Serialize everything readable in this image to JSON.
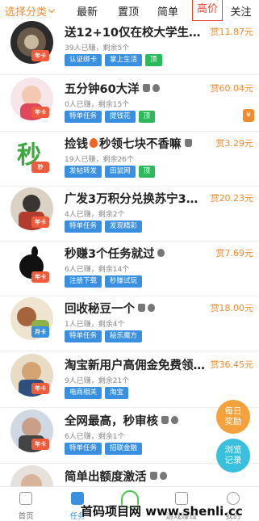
{
  "topbar": {
    "filter_label": "选择分类",
    "tabs": [
      {
        "label": "最新",
        "active": false
      },
      {
        "label": "置顶",
        "active": false
      },
      {
        "label": "简单",
        "active": false
      },
      {
        "label": "高价",
        "active": true
      },
      {
        "label": "关注",
        "active": false
      }
    ]
  },
  "items": [
    {
      "title": "送12+10仅在校大学生认...",
      "price": "赏11.87元",
      "meta": "39人已赚，剩余5个",
      "tags": [
        "认证绑卡",
        "掌上生活",
        "顶"
      ],
      "badge": "年卡",
      "platform_icons": [],
      "fire": false
    },
    {
      "title": "五分钟60大洋",
      "price": "赏60.04元",
      "meta": "0人已赚，剩余15个",
      "tags": [
        "特单任务",
        "提钱花",
        "顶"
      ],
      "badge": "年卡",
      "platform_icons": [
        "android-icon",
        "apple-icon"
      ],
      "fire": false
    },
    {
      "title": "捡钱",
      "title2": "秒领七块不香嘛",
      "price": "赏3.29元",
      "meta": "19人已赚，剩余26个",
      "tags": [
        "发帖转发",
        "田鼠网",
        "顶"
      ],
      "badge": "秒",
      "platform_icons": [
        "android-icon"
      ],
      "fire": true
    },
    {
      "title": "广发3万积分兑换苏宁30...",
      "price": "赏20.23元",
      "meta": "4人已赚，剩余2个",
      "tags": [
        "特单任务",
        "发现精彩"
      ],
      "badge": "年卡",
      "platform_icons": [],
      "fire": false
    },
    {
      "title": "秒赚3个任务就过",
      "price": "赏7.69元",
      "meta": "6人已赚，剩余14个",
      "tags": [
        "注册下载",
        "秒赚试玩"
      ],
      "badge": "年卡",
      "platform_icons": [
        "apple-icon"
      ],
      "fire": false
    },
    {
      "title": "回收秘豆一个",
      "price": "赏18.00元",
      "meta": "1人已赚，剩余4个",
      "tags": [
        "特单任务",
        "秘乐魔方"
      ],
      "badge": "月卡",
      "platform_icons": [
        "android-icon",
        "apple-icon"
      ],
      "fire": false
    },
    {
      "title": "淘宝新用户高佣金免费领...",
      "price": "赏36.45元",
      "meta": "9人已赚，剩余21个",
      "tags": [
        "电商相关",
        "淘宝"
      ],
      "badge": "年卡",
      "platform_icons": [],
      "fire": false
    },
    {
      "title": "全网最高，秒审核",
      "price": "",
      "meta": "6人已赚，剩余1个",
      "tags": [
        "特单任务",
        "招联金融"
      ],
      "badge": "年卡",
      "platform_icons": [
        "android-icon",
        "apple-icon"
      ],
      "fire": false
    },
    {
      "title": "简单出额度激活",
      "price": "",
      "meta": "",
      "tags": [],
      "badge": "",
      "platform_icons": [
        "android-icon",
        "apple-icon"
      ],
      "fire": false
    }
  ],
  "side_badge": "¥",
  "float_buttons": [
    {
      "label": "每日\n奖励",
      "color": "#f5a23c"
    },
    {
      "label": "浏览\n记录",
      "color": "#39c0dd"
    }
  ],
  "bottom_nav": [
    {
      "label": "首页",
      "icon": "home-icon",
      "active": false
    },
    {
      "label": "任务",
      "icon": "task-icon",
      "active": true
    },
    {
      "label": "",
      "icon": "publish-icon",
      "active": false
    },
    {
      "label": "游戏赚钱",
      "icon": "game-icon",
      "active": false
    },
    {
      "label": "我的",
      "icon": "user-icon",
      "active": false
    }
  ],
  "watermark": "首码项目网 www.shenli.cc",
  "colors": {
    "accent": "#f08c2e",
    "tag_blue": "#3a90e0",
    "tag_green": "#2cb95c",
    "active_tab": "#e8452f"
  }
}
